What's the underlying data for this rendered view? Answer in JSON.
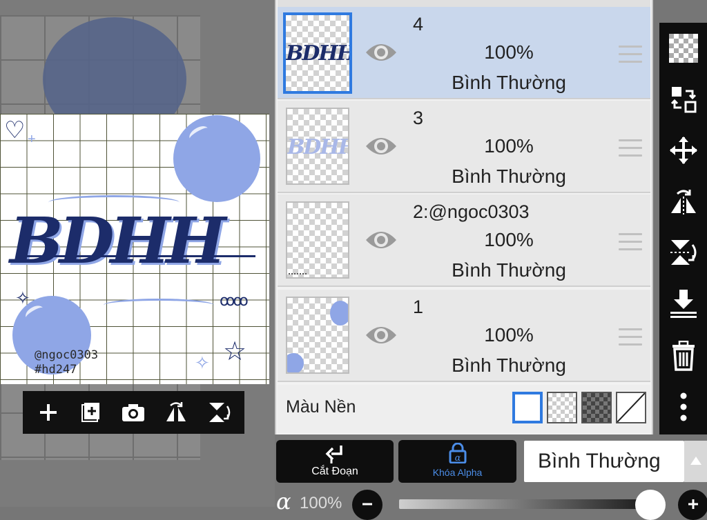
{
  "canvas": {
    "watermark_line1": "@ngoc0303",
    "watermark_line2": "#hd247",
    "artwork_text": "BDHH"
  },
  "quick_bar": {
    "items": [
      "add-layer-icon",
      "add-layer-copy-icon",
      "camera-icon",
      "flip-horizontal-icon",
      "flip-vertical-icon"
    ]
  },
  "layers": [
    {
      "name": "4",
      "opacity": "100%",
      "blend": "Bình Thường",
      "selected": true,
      "thumb_text": "BDHH"
    },
    {
      "name": "3",
      "opacity": "100%",
      "blend": "Bình Thường",
      "selected": false,
      "thumb_text": "BDHH"
    },
    {
      "name": "2:@ngoc0303",
      "opacity": "100%",
      "blend": "Bình Thường",
      "selected": false,
      "thumb_text": ""
    },
    {
      "name": "1",
      "opacity": "100%",
      "blend": "Bình Thường",
      "selected": false,
      "thumb_text": ""
    }
  ],
  "background": {
    "label": "Màu Nền",
    "options": [
      "white",
      "transparent",
      "dark-checker",
      "none"
    ],
    "selected": "white"
  },
  "bottom": {
    "cut_label": "Cắt Đoạn",
    "alpha_lock_label": "Khóa Alpha",
    "blend_mode": "Bình Thường",
    "opacity_label": "100%"
  },
  "colors": {
    "accent": "#2f7ae0",
    "selected_layer": "#c9d7ec",
    "toolbar": "#0e0e0e",
    "art_navy": "#1c2c6a",
    "art_bubble": "#8fa6e6"
  }
}
